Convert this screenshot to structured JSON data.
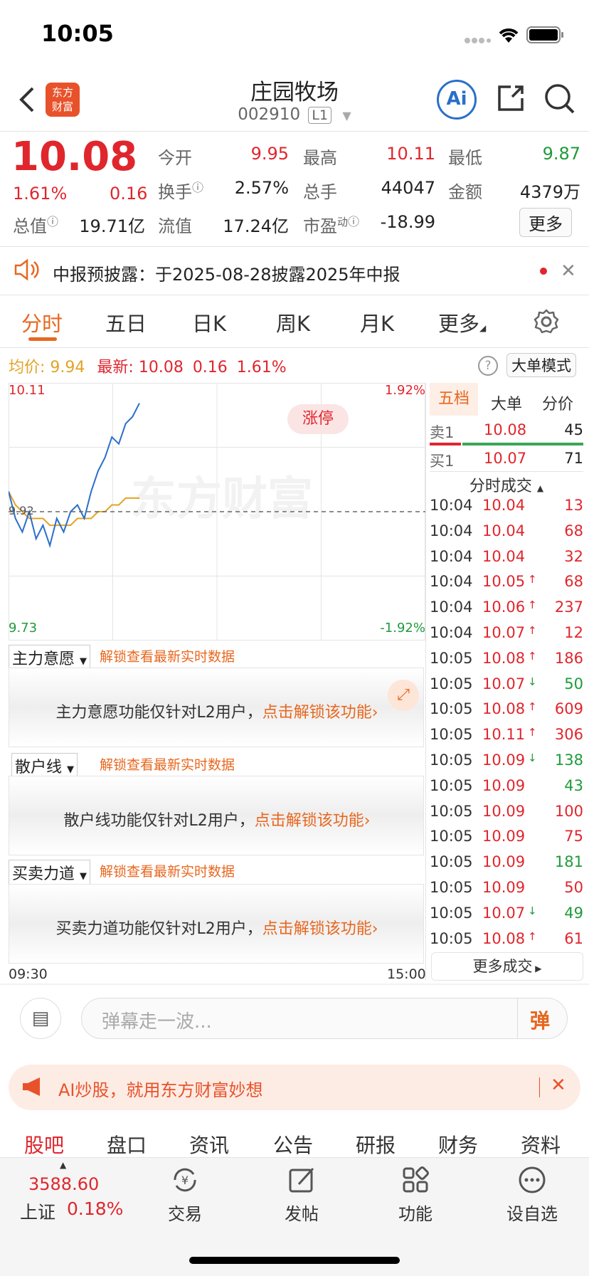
{
  "status_bar": {
    "time": "10:05"
  },
  "header": {
    "title": "庄园牧场",
    "code": "002910",
    "level_badge": "L1",
    "logo_text": "东方\n财富",
    "ai_label": "Ai"
  },
  "quote": {
    "price": "10.08",
    "change_pct": "1.61%",
    "change_amt": "0.16",
    "stats": [
      {
        "label": "今开",
        "value": "9.95",
        "color": "red"
      },
      {
        "label": "最高",
        "value": "10.11",
        "color": "red"
      },
      {
        "label": "最低",
        "value": "9.87",
        "color": "green"
      },
      {
        "label": "换手",
        "value": "2.57%",
        "color": "black"
      },
      {
        "label": "总手",
        "value": "44047",
        "color": "black"
      },
      {
        "label": "金额",
        "value": "4379万",
        "color": "black"
      },
      {
        "label": "总值",
        "value": "19.71亿",
        "color": "black"
      },
      {
        "label": "流值",
        "value": "17.24亿",
        "color": "black"
      },
      {
        "label": "市盈",
        "sup": "动",
        "value": "-18.99",
        "color": "black"
      }
    ],
    "more_label": "更多"
  },
  "notice": {
    "text": "中报预披露：于2025-08-28披露2025年中报"
  },
  "tabs": [
    "分时",
    "五日",
    "日K",
    "周K",
    "月K",
    "更多"
  ],
  "legend": {
    "avg_label": "均价:",
    "avg_value": "9.94",
    "latest_label": "最新:",
    "latest_value": "10.08",
    "latest_chg": "0.16",
    "latest_pct": "1.61%",
    "big_order_mode": "大单模式"
  },
  "chart_data": {
    "type": "line",
    "title": "",
    "y_top": "10.11",
    "y_bottom": "9.73",
    "pct_top": "1.92%",
    "pct_bottom": "-1.92%",
    "x_start": "09:30",
    "x_end": "15:00",
    "ylim": [
      9.73,
      10.11
    ],
    "prev_close": 9.92,
    "prev_close_label": "9.92",
    "limit_badge": "涨停",
    "watermark": "东方财富",
    "price_series": [
      9.95,
      9.91,
      9.89,
      9.92,
      9.88,
      9.9,
      9.87,
      9.91,
      9.89,
      9.92,
      9.93,
      9.91,
      9.95,
      9.98,
      10.0,
      10.03,
      10.02,
      10.05,
      10.06,
      10.08
    ],
    "avg_series": [
      9.95,
      9.93,
      9.92,
      9.91,
      9.91,
      9.91,
      9.9,
      9.9,
      9.9,
      9.9,
      9.91,
      9.91,
      9.91,
      9.92,
      9.92,
      9.93,
      9.93,
      9.94,
      9.94,
      9.94
    ],
    "colors": {
      "price": "#2a6fc9",
      "avg": "#e3a325",
      "grid": "#e4e4e4",
      "dashed": "#666666"
    }
  },
  "indicators": [
    {
      "name": "主力意愿",
      "hint": "解锁查看最新实时数据",
      "msg": "主力意愿功能仅针对L2用户，",
      "link": "点击解锁该功能"
    },
    {
      "name": "散户线",
      "hint": "解锁查看最新实时数据",
      "msg": "散户线功能仅针对L2用户，",
      "link": "点击解锁该功能"
    },
    {
      "name": "买卖力道",
      "hint": "解锁查看最新实时数据",
      "msg": "买卖力道功能仅针对L2用户，",
      "link": "点击解锁该功能"
    }
  ],
  "side_tabs": [
    "五档",
    "大单",
    "分价"
  ],
  "order_book": [
    {
      "label": "卖1",
      "price": "10.08",
      "vol": "45"
    },
    {
      "label": "买1",
      "price": "10.07",
      "vol": "71"
    }
  ],
  "trades_title": "分时成交",
  "trades": [
    {
      "t": "10:04",
      "p": "10.04",
      "a": "",
      "v": "13",
      "vc": "red"
    },
    {
      "t": "10:04",
      "p": "10.04",
      "a": "",
      "v": "68",
      "vc": "red"
    },
    {
      "t": "10:04",
      "p": "10.04",
      "a": "",
      "v": "32",
      "vc": "red"
    },
    {
      "t": "10:04",
      "p": "10.05",
      "a": "↑",
      "v": "68",
      "vc": "red"
    },
    {
      "t": "10:04",
      "p": "10.06",
      "a": "↑",
      "v": "237",
      "vc": "red"
    },
    {
      "t": "10:04",
      "p": "10.07",
      "a": "↑",
      "v": "12",
      "vc": "red"
    },
    {
      "t": "10:05",
      "p": "10.08",
      "a": "↑",
      "v": "186",
      "vc": "red"
    },
    {
      "t": "10:05",
      "p": "10.07",
      "a": "↓",
      "v": "50",
      "vc": "green"
    },
    {
      "t": "10:05",
      "p": "10.08",
      "a": "↑",
      "v": "609",
      "vc": "red"
    },
    {
      "t": "10:05",
      "p": "10.11",
      "a": "↑",
      "v": "306",
      "vc": "red"
    },
    {
      "t": "10:05",
      "p": "10.09",
      "a": "↓",
      "v": "138",
      "vc": "green"
    },
    {
      "t": "10:05",
      "p": "10.09",
      "a": "",
      "v": "43",
      "vc": "green"
    },
    {
      "t": "10:05",
      "p": "10.09",
      "a": "",
      "v": "100",
      "vc": "red"
    },
    {
      "t": "10:05",
      "p": "10.09",
      "a": "",
      "v": "75",
      "vc": "red"
    },
    {
      "t": "10:05",
      "p": "10.09",
      "a": "",
      "v": "181",
      "vc": "green"
    },
    {
      "t": "10:05",
      "p": "10.09",
      "a": "",
      "v": "50",
      "vc": "red"
    },
    {
      "t": "10:05",
      "p": "10.07",
      "a": "↓",
      "v": "49",
      "vc": "green"
    },
    {
      "t": "10:05",
      "p": "10.08",
      "a": "↑",
      "v": "61",
      "vc": "red"
    }
  ],
  "more_trades": "更多成交",
  "danmu": {
    "placeholder": "弹幕走一波...",
    "send": "弹"
  },
  "ad": {
    "text": "AI炒股，就用东方财富妙想"
  },
  "bottom_tabs": [
    "股吧",
    "盘口",
    "资讯",
    "公告",
    "研报",
    "财务",
    "资料"
  ],
  "index": {
    "value": "3588.60",
    "name": "上证",
    "pct": "0.18%"
  },
  "nav": [
    "交易",
    "发帖",
    "功能",
    "设自选"
  ]
}
